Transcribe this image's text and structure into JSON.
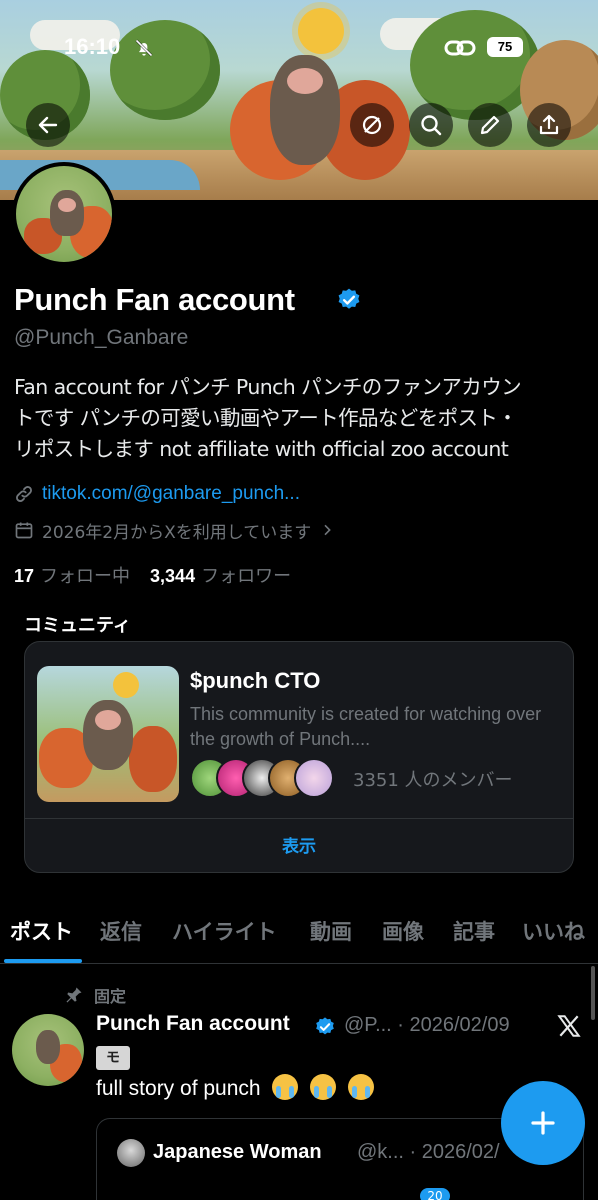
{
  "status_bar": {
    "time": "16:10",
    "battery": "75"
  },
  "profile": {
    "name": "Punch Fan account",
    "handle": "@Punch_Ganbare",
    "bio_lines": [
      "Fan account for パンチ Punch パンチのファンアカウン",
      "トです パンチの可愛い動画やアート作品などをポスト・",
      "リポストします not affiliate with official zoo account"
    ],
    "link": "tiktok.com/@ganbare_punch...",
    "joined": "2026年2月からXを利用しています",
    "following_count": "17",
    "following_label": "フォロー中",
    "followers_count": "3,344",
    "followers_label": "フォロワー"
  },
  "community": {
    "heading": "コミュニティ",
    "title": "$punch CTO",
    "description": "This community is created for watching over the growth of Punch....",
    "member_count": "3351 人のメンバー",
    "show_label": "表示"
  },
  "tabs": [
    {
      "label": "ポスト",
      "active": true
    },
    {
      "label": "返信"
    },
    {
      "label": "ハイライト"
    },
    {
      "label": "動画"
    },
    {
      "label": "画像"
    },
    {
      "label": "記事"
    },
    {
      "label": "いいね"
    }
  ],
  "pinned_post": {
    "pinned_label": "固定",
    "author": "Punch Fan account",
    "meta": "@P... · 2026/02/09",
    "label_badge": "モ",
    "text": "full story of punch",
    "quote": {
      "author": "Japanese Woman",
      "meta": "@k... · 2026/02/"
    }
  },
  "bottom_badge": "20",
  "colors": {
    "accent": "#1d9bf0",
    "background": "#000000",
    "secondary_text": "#71767b"
  },
  "icons": [
    "back-arrow-icon",
    "no-bell-icon",
    "link-icon",
    "search-icon",
    "edit-icon",
    "share-icon",
    "verified-badge-icon",
    "calendar-icon",
    "pin-icon",
    "x-logo-icon",
    "plus-icon"
  ]
}
